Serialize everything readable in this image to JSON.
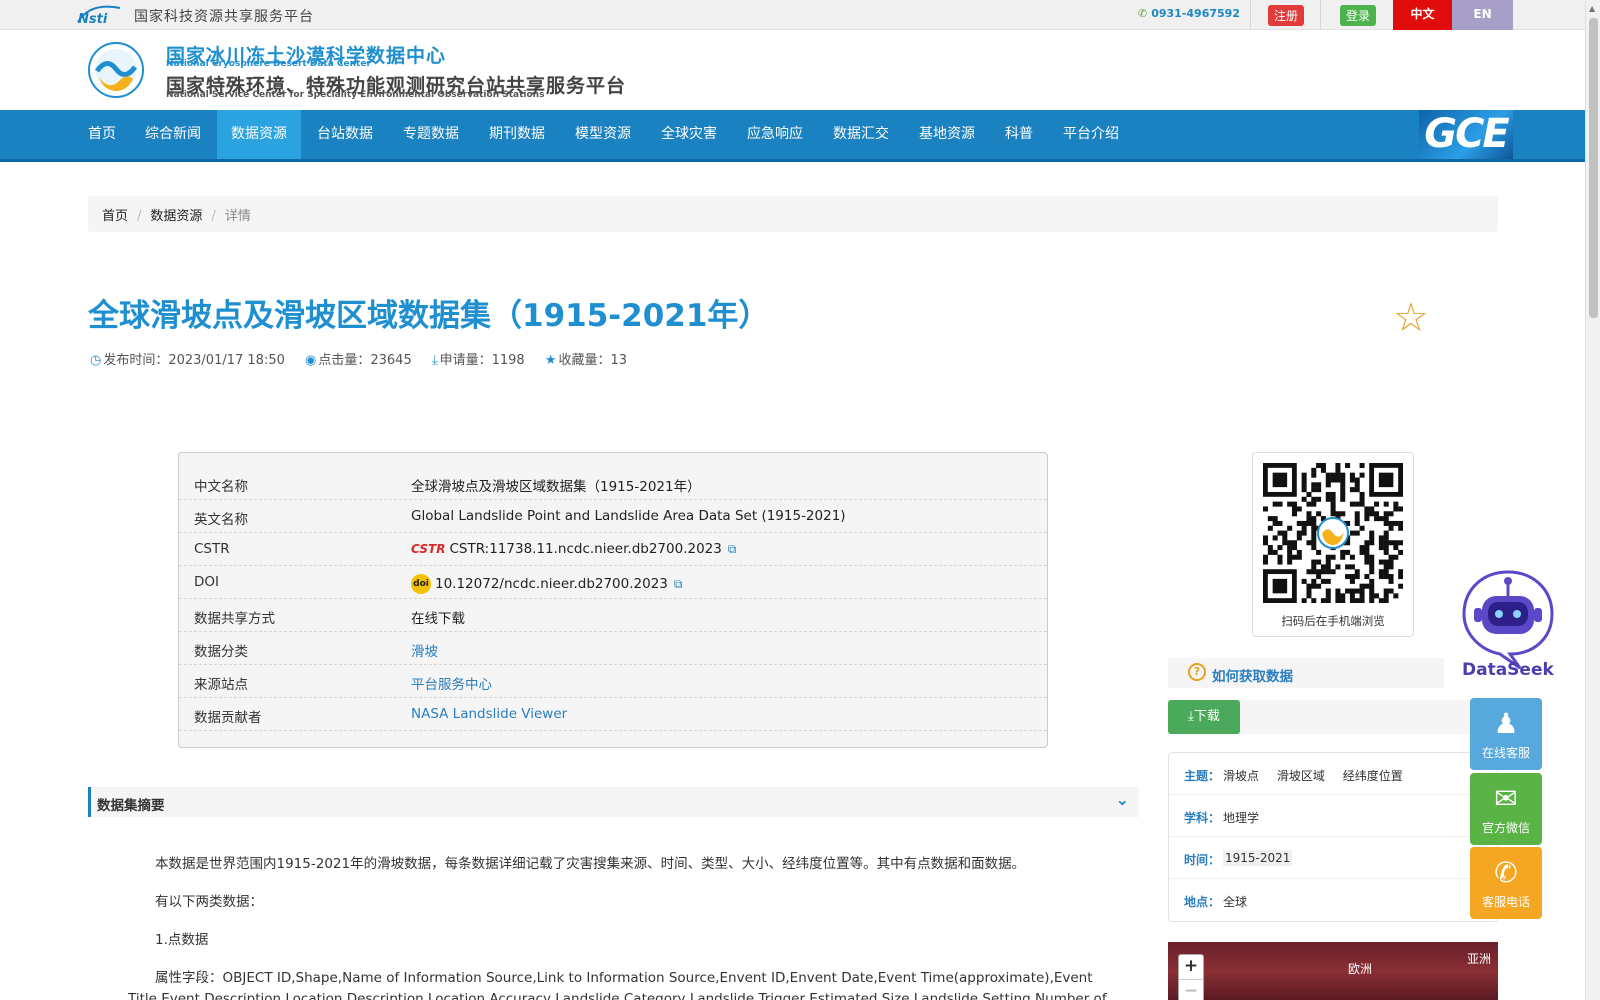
{
  "topbar": {
    "nsti_logo_text": "Nsti",
    "platform_name": "国家科技资源共享服务平台",
    "phone": "0931-4967592",
    "register_label": "注册",
    "login_label": "登录",
    "lang_cn": "中文",
    "lang_en": "EN"
  },
  "header": {
    "title_cn": "国家冰川冻土沙漠科学数据中心",
    "title_en": "National Cryosphere Desert Data Center",
    "subtitle_cn": "国家特殊环境、特殊功能观测研究台站共享服务平台",
    "subtitle_en": "National Service Center for Speciality Environmental Observation Stations"
  },
  "nav": {
    "items": [
      "首页",
      "综合新闻",
      "数据资源",
      "台站数据",
      "专题数据",
      "期刊数据",
      "模型资源",
      "全球灾害",
      "应急响应",
      "数据汇交",
      "基地资源",
      "科普",
      "平台介绍"
    ],
    "active_index": 2,
    "brand": "GCE"
  },
  "breadcrumb": {
    "home": "首页",
    "section": "数据资源",
    "current": "详情",
    "separator": "/"
  },
  "dataset": {
    "title": "全球滑坡点及滑坡区域数据集（1915-2021年）",
    "publish_label": "发布时间：2023/01/17 18:50",
    "clicks_label": "点击量：23645",
    "applications_label": "申请量：1198",
    "favorites_label": "收藏量：13"
  },
  "info": {
    "rows": [
      {
        "key": "中文名称",
        "value": "全球滑坡点及滑坡区域数据集（1915-2021年）"
      },
      {
        "key": "英文名称",
        "value": "Global Landslide Point and Landslide Area Data Set (1915-2021)"
      },
      {
        "key": "CSTR",
        "value": "CSTR:11738.11.ncdc.nieer.db2700.2023",
        "badge": "CSTR"
      },
      {
        "key": "DOI",
        "value": "10.12072/ncdc.nieer.db2700.2023",
        "badge": "doi"
      },
      {
        "key": "数据共享方式",
        "value": "在线下载"
      },
      {
        "key": "数据分类",
        "value": "滑坡"
      },
      {
        "key": "来源站点",
        "value": "平台服务中心"
      },
      {
        "key": "数据贡献者",
        "value": "NASA Landslide Viewer"
      }
    ]
  },
  "summary": {
    "heading": "数据集摘要",
    "paragraphs": [
      "本数据是世界范围内1915-2021年的滑坡数据，每条数据详细记载了灾害搜集来源、时间、类型、大小、经纬度位置等。其中有点数据和面数据。",
      "有以下两类数据：",
      "1.点数据",
      "属性字段：OBJECT ID,Shape,Name of Information Source,Link to Information Source,Envent ID,Envent Date,Event Time(approximate),Event",
      "Title,Event Description,Location Description,Location Accuracy,Landslide Category,Landslide Trigger,Estimated Size,Landslide Setting,Number of"
    ]
  },
  "sidebar": {
    "qr_caption": "扫码后在手机端浏览",
    "howto_label": "如何获取数据",
    "download_label": "下载",
    "tags": [
      {
        "key": "主题：",
        "values": [
          "滑坡点",
          "滑坡区域",
          "经纬度位置"
        ]
      },
      {
        "key": "学科：",
        "values": [
          "地理学"
        ]
      },
      {
        "key": "时间：",
        "values": [
          "1915-2021"
        ]
      },
      {
        "key": "地点：",
        "values": [
          "全球"
        ]
      }
    ],
    "map_labels": [
      "欧洲",
      "亚洲"
    ]
  },
  "floating": {
    "dataseek_label": "DataSeek",
    "online_service": "在线客服",
    "wechat": "官方微信",
    "phone_service": "客服电话"
  },
  "colors": {
    "primary_blue": "#1b82c1",
    "title_blue": "#1f8fd0",
    "register_red": "#e23b3b",
    "login_green": "#4db34d",
    "lang_cn_bg": "#e10d0d",
    "lang_en_bg": "#a89fc8",
    "download_green": "#4aa95a",
    "star_orange": "#e7a02a"
  },
  "icons": [
    "phone-icon",
    "clock-icon",
    "eye-icon",
    "download-icon",
    "star-icon",
    "external-link-icon",
    "chevron-down-icon",
    "question-icon",
    "qq-icon",
    "wechat-icon",
    "phone-call-icon",
    "robot-icon"
  ]
}
